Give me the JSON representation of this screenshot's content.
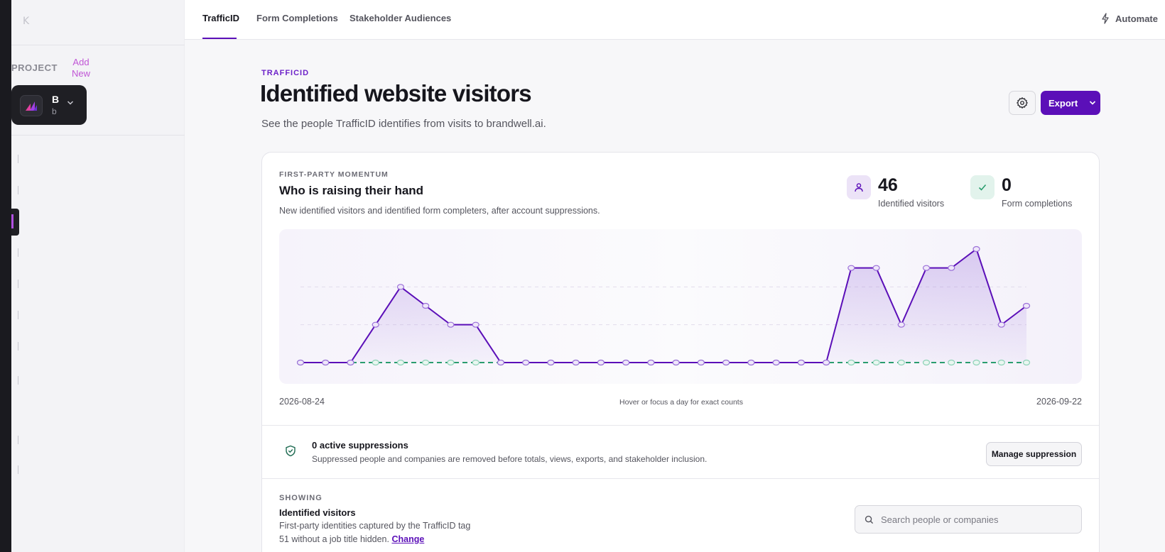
{
  "sidebar": {
    "collapse_glyph": "K",
    "project_label": "PROJECT",
    "add_new_label": "Add New",
    "project": {
      "name": "B",
      "sub": "b"
    }
  },
  "topnav": {
    "tabs": [
      {
        "label": "TrafficID",
        "active": true
      },
      {
        "label": "Form Completions",
        "active": false
      },
      {
        "label": "Stakeholder Audiences",
        "active": false
      }
    ],
    "automate_label": "Automate"
  },
  "header": {
    "eyebrow": "TRAFFICID",
    "title": "Identified website visitors",
    "subtitle": "See the people TrafficID identifies from visits to brandwell.ai.",
    "export_label": "Export"
  },
  "momentum": {
    "eyebrow": "FIRST-PARTY MOMENTUM",
    "title": "Who is raising their hand",
    "description": "New identified visitors and identified form completers, after account suppressions.",
    "stats": [
      {
        "value": "46",
        "label": "Identified visitors",
        "icon": "user-icon"
      },
      {
        "value": "0",
        "label": "Form completions",
        "icon": "check-icon"
      }
    ],
    "axis_start": "2026-08-24",
    "axis_end": "2026-09-22",
    "axis_hint": "Hover or focus a day for exact counts"
  },
  "chart_data": {
    "type": "area",
    "x_start": "2026-08-24",
    "x_end": "2026-09-22",
    "series": [
      {
        "name": "Identified visitors",
        "color": "#5b0fb8",
        "values": [
          0,
          0,
          0,
          2,
          4,
          3,
          2,
          2,
          0,
          0,
          0,
          0,
          0,
          0,
          0,
          0,
          0,
          0,
          0,
          0,
          0,
          0,
          5,
          5,
          2,
          5,
          5,
          6,
          2,
          3
        ]
      },
      {
        "name": "Form completions",
        "color": "#2a9d6f",
        "values": [
          0,
          0,
          0,
          0,
          0,
          0,
          0,
          0,
          0,
          0,
          0,
          0,
          0,
          0,
          0,
          0,
          0,
          0,
          0,
          0,
          0,
          0,
          0,
          0,
          0,
          0,
          0,
          0,
          0,
          0
        ]
      }
    ],
    "ylim": [
      0,
      6.3
    ],
    "grid": true
  },
  "suppressions": {
    "title": "0 active suppressions",
    "description": "Suppressed people and companies are removed before totals, views, exports, and stakeholder inclusion.",
    "button_label": "Manage suppression"
  },
  "showing": {
    "label": "SHOWING",
    "title": "Identified visitors",
    "description": "First-party identities captured by the TrafficID tag",
    "hidden_text": "51 without a job title hidden.",
    "change_label": "Change"
  },
  "search": {
    "placeholder": "Search people or companies",
    "value": ""
  },
  "colors": {
    "accent": "#5b0fb8",
    "success": "#2a9d6f",
    "brand_pink": "#c056d6"
  }
}
